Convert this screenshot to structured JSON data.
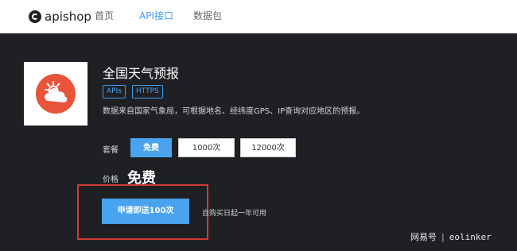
{
  "nav": {
    "logo_text": "apishop",
    "links": [
      "首页",
      "API接口",
      "数据包"
    ],
    "active_index": 1
  },
  "product": {
    "icon": "sun-cloud-icon",
    "title": "全国天气预报",
    "tags": [
      "APIs",
      "HTTPS"
    ],
    "description": "数据来自国家气象局，可根据地名、经纬度GPS、IP查询对应地区的预报。"
  },
  "plan": {
    "label": "套餐",
    "options": [
      "免费",
      "1000次",
      "12000次"
    ],
    "selected_index": 0
  },
  "price": {
    "label": "价格",
    "value": "免费"
  },
  "apply": {
    "button_label": "申请即送100次",
    "validity": "自购买日起一年可用"
  },
  "watermark": {
    "brand": "网易号",
    "separator": "|",
    "handle": "eolinker"
  },
  "colors": {
    "accent": "#4aa3ef",
    "highlight": "#d13b30",
    "icon": "#e8533a",
    "background": "#1f2024"
  }
}
